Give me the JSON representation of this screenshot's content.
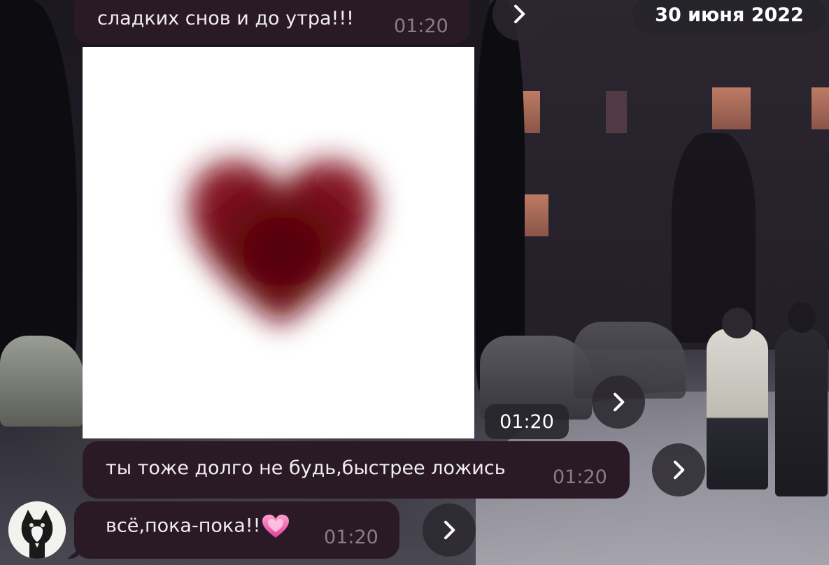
{
  "date_separator": "30 июня 2022",
  "messages": [
    {
      "text": "сладких снов и до утра!!!",
      "time": "01:20"
    },
    {
      "type": "photo",
      "time": "01:20"
    },
    {
      "text": "ты тоже долго не будь,быстрее ложись",
      "time": "01:20"
    },
    {
      "text": "всё,пока-пока!!",
      "emoji": "growing-heart-emoji",
      "time": "01:20"
    }
  ],
  "colors": {
    "bubble_bg": "#2a1a25",
    "time_text": "#8b7d86",
    "heart": "#6e0a14"
  }
}
